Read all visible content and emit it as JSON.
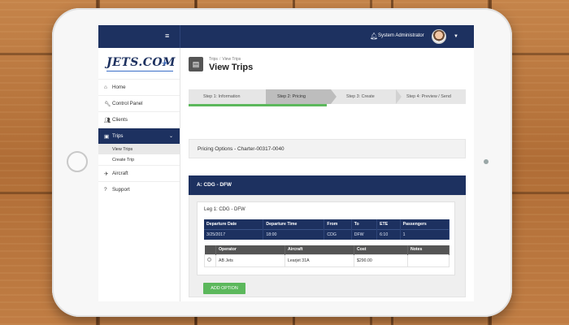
{
  "header": {
    "admin_name": "System Administrator",
    "menu_icon": "hamburger-menu-icon",
    "bell_icon": "bell-icon"
  },
  "logo": {
    "text": "JETS.COM"
  },
  "sidebar": {
    "items": [
      {
        "label": "Home",
        "icon": "home-icon"
      },
      {
        "label": "Control Panel",
        "icon": "wrench-icon"
      },
      {
        "label": "Clients",
        "icon": "users-icon"
      },
      {
        "label": "Trips",
        "icon": "briefcase-icon",
        "active": true
      },
      {
        "label": "Aircraft",
        "icon": "plane-icon"
      },
      {
        "label": "Support",
        "icon": "question-icon"
      }
    ],
    "trips_sub": [
      {
        "label": "View Trips",
        "active": true
      },
      {
        "label": "Create Trip"
      }
    ]
  },
  "page": {
    "breadcrumb": [
      "Trips",
      "View Trips"
    ],
    "title": "View Trips"
  },
  "steps": [
    {
      "label": "Step 1: Information"
    },
    {
      "label": "Step 2: Pricing",
      "active": true
    },
    {
      "label": "Step 3: Create"
    },
    {
      "label": "Step 4: Preview / Send"
    }
  ],
  "pricing": {
    "label": "Pricing Options - Charter-00317-0040"
  },
  "route": {
    "label": "A: CDG - DFW"
  },
  "leg": {
    "title": "Leg 1: CDG - DFW",
    "columns": [
      "Departure Date",
      "Departure Time",
      "From",
      "To",
      "ETE",
      "Passengers"
    ],
    "row": [
      "3/25/2017",
      "18:00",
      "CDG",
      "DFW",
      "6:10",
      "1"
    ]
  },
  "operators": {
    "columns": [
      "",
      "Operator",
      "Aircraft",
      "Cost",
      "Notes"
    ],
    "rows": [
      [
        "",
        "AB Jets",
        "Learjet 31A",
        "$290.00",
        ""
      ]
    ]
  },
  "buttons": {
    "add_option": "ADD OPTION"
  },
  "colors": {
    "navy": "#1d3160",
    "green": "#5cb85c"
  }
}
